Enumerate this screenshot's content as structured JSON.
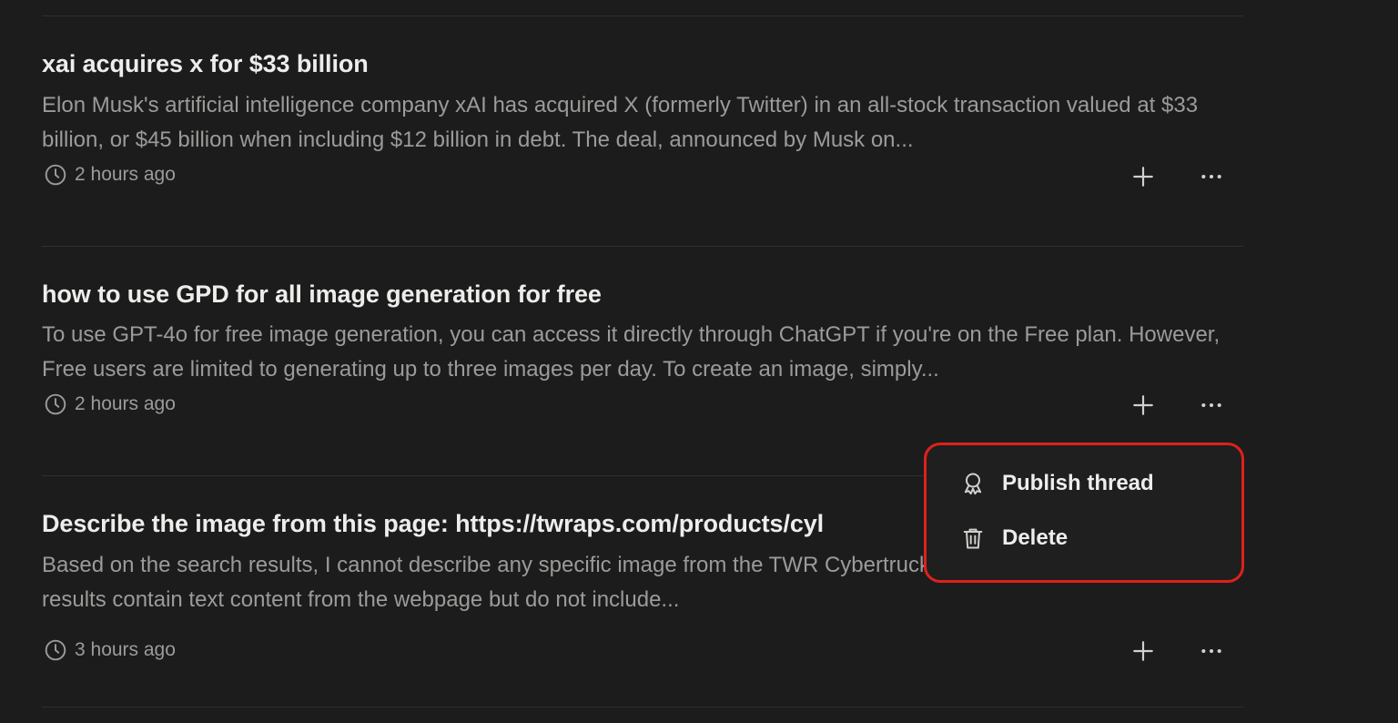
{
  "threads": [
    {
      "title": "xai acquires x for $33 billion",
      "snippet": "Elon Musk's artificial intelligence company xAI has acquired X (formerly Twitter) in an all-stock transaction valued at $33 billion, or $45 billion when including $12 billion in debt. The deal, announced by Musk on...",
      "time": "2 hours ago"
    },
    {
      "title": "how to use GPD for all image generation for free",
      "snippet": "To use GPT-4o for free image generation, you can access it directly through ChatGPT if you're on the Free plan. However, Free users are limited to generating up to three images per day. To create an image, simply...",
      "time": "2 hours ago"
    },
    {
      "title": "Describe the image from this page: https://twraps.com/products/cyl",
      "snippet": "Based on the search results, I cannot describe any specific image from the TWR Cybertruck PPF color wraps. The search results contain text content from the webpage but do not include...",
      "time": "3 hours ago"
    }
  ],
  "menu": {
    "publish_label": "Publish thread",
    "delete_label": "Delete"
  },
  "icons": {
    "clock": "clock-icon",
    "plus": "plus-icon",
    "more": "more-horizontal-icon",
    "publish": "publish-icon",
    "delete": "trash-icon"
  },
  "colors": {
    "background": "#1c1c1c",
    "title": "#ededeb",
    "muted": "#9b9b99",
    "highlight": "#e0201b"
  }
}
